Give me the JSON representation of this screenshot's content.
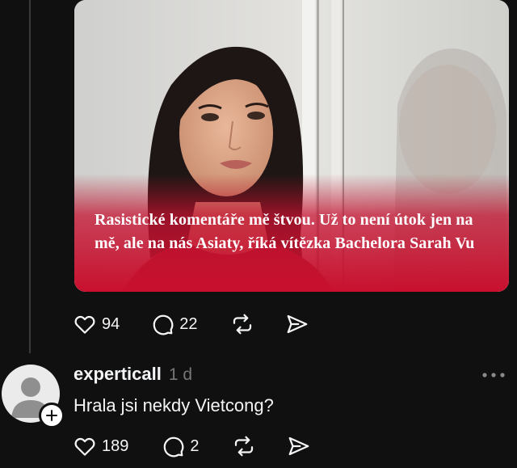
{
  "post": {
    "headline": "Rasistické komentáře mě štvou. Už to není útok jen na mě, ale na nás Asiaty, říká vítězka Bachelora Sarah Vu",
    "likes": "94",
    "comments": "22"
  },
  "reply": {
    "username": "experticall",
    "time": "1 d",
    "text": "Hrala jsi nekdy Vietcong?",
    "likes": "189",
    "comments": "2"
  },
  "icons": {
    "like": "heart-icon",
    "comment": "comment-bubble-icon",
    "repost": "repost-icon",
    "share": "send-icon",
    "more": "more-dots-icon",
    "follow": "plus-icon"
  },
  "colors": {
    "background": "#101010",
    "text": "#f3f5f7",
    "muted": "#777777",
    "headline_band": "#c8102e"
  }
}
